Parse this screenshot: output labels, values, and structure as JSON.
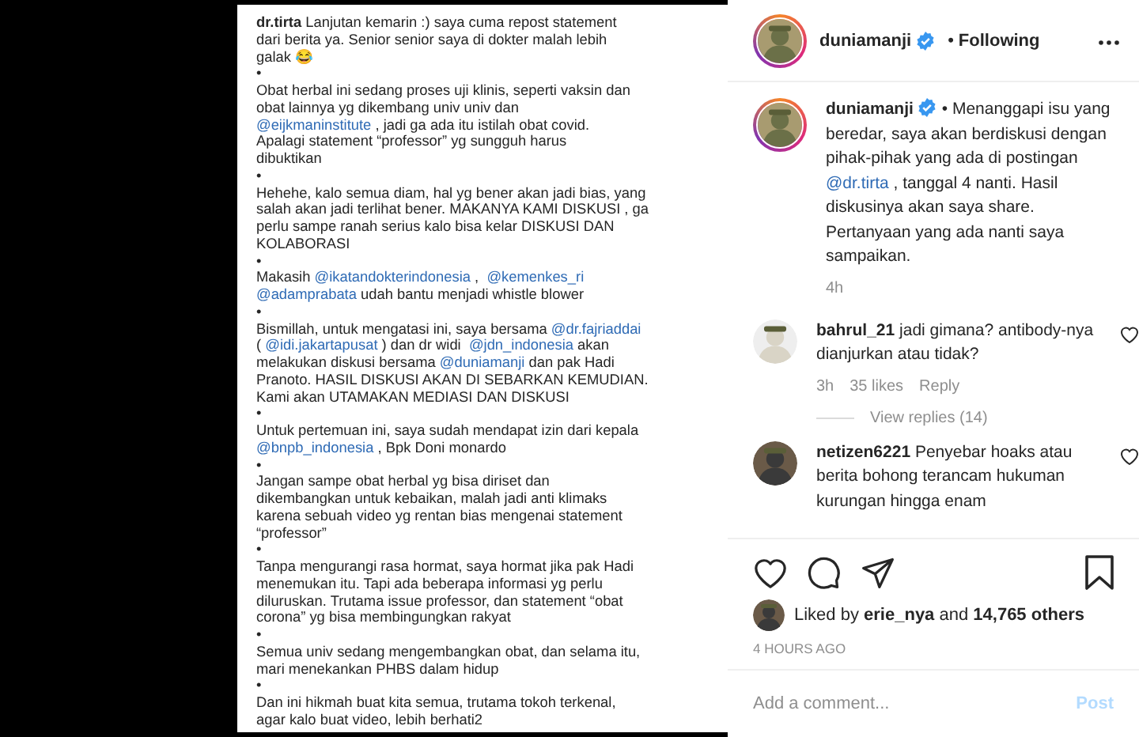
{
  "post_image": {
    "lines": [
      [
        {
          "text": "dr.tirta",
          "kind": "bold"
        },
        {
          "text": " Lanjutan kemarin :) saya cuma repost statement",
          "kind": "plain"
        }
      ],
      "dari berita ya. Senior senior saya di dokter malah lebih",
      "galak 😂",
      "•",
      "Obat herbal ini sedang proses uji klinis, seperti vaksin dan",
      "obat lainnya yg dikembang univ univ dan",
      [
        {
          "text": "@eijkmaninstitute",
          "kind": "mention"
        },
        {
          "text": " , jadi ga ada itu istilah obat covid.",
          "kind": "plain"
        }
      ],
      "Apalagi statement “professor” yg sungguh harus",
      "dibuktikan",
      "•",
      "Hehehe, kalo semua diam, hal yg bener akan jadi bias, yang",
      "salah akan jadi terlihat bener. MAKANYA KAMI DISKUSI , ga",
      "perlu sampe ranah serius kalo bisa kelar DISKUSI DAN",
      "KOLABORASI",
      "•",
      [
        {
          "text": "Makasih ",
          "kind": "plain"
        },
        {
          "text": "@ikatandokterindonesia",
          "kind": "mention"
        },
        {
          "text": " ,  ",
          "kind": "plain"
        },
        {
          "text": "@kemenkes_ri",
          "kind": "mention"
        }
      ],
      [
        {
          "text": "@adamprabata",
          "kind": "mention"
        },
        {
          "text": " udah bantu menjadi whistle blower",
          "kind": "plain"
        }
      ],
      "•",
      [
        {
          "text": "Bismillah, untuk mengatasi ini, saya bersama ",
          "kind": "plain"
        },
        {
          "text": "@dr.fajriaddai",
          "kind": "mention"
        }
      ],
      [
        {
          "text": "( ",
          "kind": "plain"
        },
        {
          "text": "@idi.jakartapusat",
          "kind": "mention"
        },
        {
          "text": " ) dan dr widi  ",
          "kind": "plain"
        },
        {
          "text": "@jdn_indonesia",
          "kind": "mention"
        },
        {
          "text": " akan",
          "kind": "plain"
        }
      ],
      [
        {
          "text": "melakukan diskusi bersama ",
          "kind": "plain"
        },
        {
          "text": "@duniamanji",
          "kind": "mention"
        },
        {
          "text": " dan pak Hadi",
          "kind": "plain"
        }
      ],
      "Pranoto. HASIL DISKUSI AKAN DI SEBARKAN KEMUDIAN.",
      "Kami akan UTAMAKAN MEDIASI DAN DISKUSI",
      "•",
      "Untuk pertemuan ini, saya sudah mendapat izin dari kepala",
      [
        {
          "text": "@bnpb_indonesia",
          "kind": "mention"
        },
        {
          "text": " , Bpk Doni monardo",
          "kind": "plain"
        }
      ],
      "•",
      "Jangan sampe obat herbal yg bisa diriset dan",
      "dikembangkan untuk kebaikan, malah jadi anti klimaks",
      "karena sebuah video yg rentan bias mengenai statement",
      "“professor”",
      "•",
      "Tanpa mengurangi rasa hormat, saya hormat jika pak Hadi",
      "menemukan itu. Tapi ada beberapa informasi yg perlu",
      "diluruskan. Trutama issue professor, dan statement “obat",
      "corona” yg bisa membingungkan rakyat",
      "•",
      "Semua univ sedang mengembangkan obat, dan selama itu,",
      "mari menekankan PHBS dalam hidup",
      "•",
      "Dan ini hikmah buat kita semua, trutama tokoh terkenal,",
      "agar kalo buat video, lebih berhati2"
    ]
  },
  "header": {
    "username": "duniamanji",
    "verified": true,
    "separator": "•",
    "follow_status": "Following"
  },
  "caption": {
    "username": "duniamanji",
    "verified": true,
    "segments": [
      {
        "text": "• Menanggapi isu yang beredar, saya akan berdiskusi dengan pihak-pihak yang ada di postingan ",
        "kind": "plain"
      },
      {
        "text": "@dr.tirta",
        "kind": "mention"
      },
      {
        "text": " , tanggal 4 nanti. Hasil diskusinya akan saya share. Pertanyaan yang ada nanti saya sampaikan.",
        "kind": "plain"
      }
    ],
    "time": "4h"
  },
  "comments": [
    {
      "username": "bahrul_21",
      "text": "jadi gimana? antibody-nya dianjurkan atau tidak?",
      "liked": false,
      "time": "3h",
      "likes": "35 likes",
      "reply": "Reply",
      "view_replies": "View replies (14)"
    },
    {
      "username": "netizen6221",
      "text": "Penyebar hoaks atau berita bohong terancam hukuman kurungan hingga enam",
      "liked": false
    }
  ],
  "likes": {
    "text": "Liked by **erie_nya** and **14,765 others**"
  },
  "timestamp": "4 HOURS AGO",
  "comment_box": {
    "placeholder": "Add a comment...",
    "button": "Post",
    "disabled": true
  }
}
